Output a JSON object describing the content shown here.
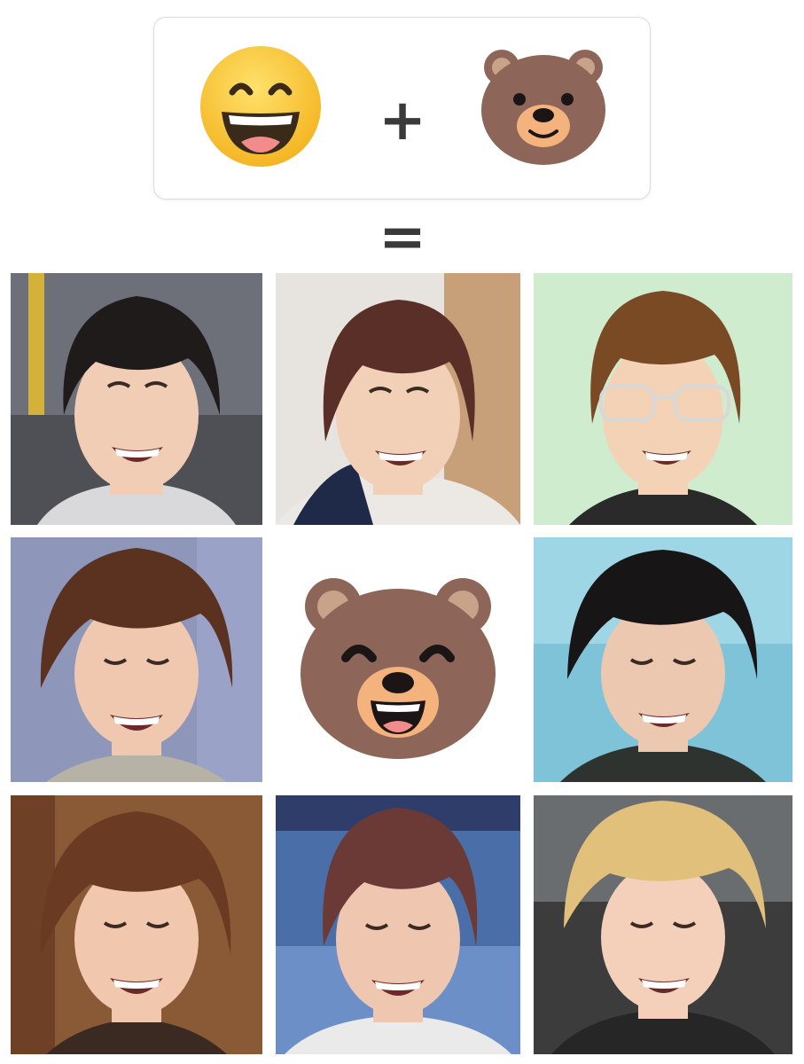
{
  "equation": {
    "left_emoji": "grinning-face-with-smiling-eyes",
    "operator": "+",
    "right_emoji": "bear-face",
    "equals": "="
  },
  "result_emoji": "laughing-bear-face",
  "photos": [
    {
      "id": "photo-1",
      "bg": "#6d7078",
      "hair": "#1f1b1a",
      "skin": "#f1cdb6",
      "shirt": "#d9d9dc",
      "eyes": "open"
    },
    {
      "id": "photo-2",
      "bg": "#c7a07a",
      "hair": "#5a2f28",
      "skin": "#f2d0b8",
      "shirt": "#ece8e4",
      "eyes": "open"
    },
    {
      "id": "photo-3",
      "bg": "#cfeccf",
      "hair": "#7a4a24",
      "skin": "#f3d2b6",
      "shirt": "#2a2a2a",
      "eyes": "glasses"
    },
    {
      "id": "photo-4",
      "bg": "#8e96b9",
      "hair": "#5b3220",
      "skin": "#f0c8b0",
      "shirt": "#b7b2a6",
      "eyes": "closed"
    },
    {
      "id": "photo-6",
      "bg": "#7fc3d8",
      "hair": "#171515",
      "skin": "#ecc8b0",
      "shirt": "#2e3330",
      "eyes": "closed"
    },
    {
      "id": "photo-7",
      "bg": "#8a5a36",
      "hair": "#6a3a22",
      "skin": "#f1c8ae",
      "shirt": "#3a2a22",
      "eyes": "closed"
    },
    {
      "id": "photo-8",
      "bg": "#4a6fa8",
      "hair": "#6b3a36",
      "skin": "#efc7b0",
      "shirt": "#eaeaea",
      "eyes": "closed"
    },
    {
      "id": "photo-9",
      "bg": "#6a6d70",
      "hair": "#e0c07a",
      "skin": "#f4d0bb",
      "shirt": "#262626",
      "eyes": "closed"
    }
  ],
  "colors": {
    "bear_fur": "#8d6659",
    "bear_ear_inner": "#c9a28a",
    "bear_muzzle": "#f4b27c",
    "smiley_yellow": "#fbc931",
    "smiley_mouth": "#3a2a1a",
    "tongue": "#f28c8c"
  }
}
